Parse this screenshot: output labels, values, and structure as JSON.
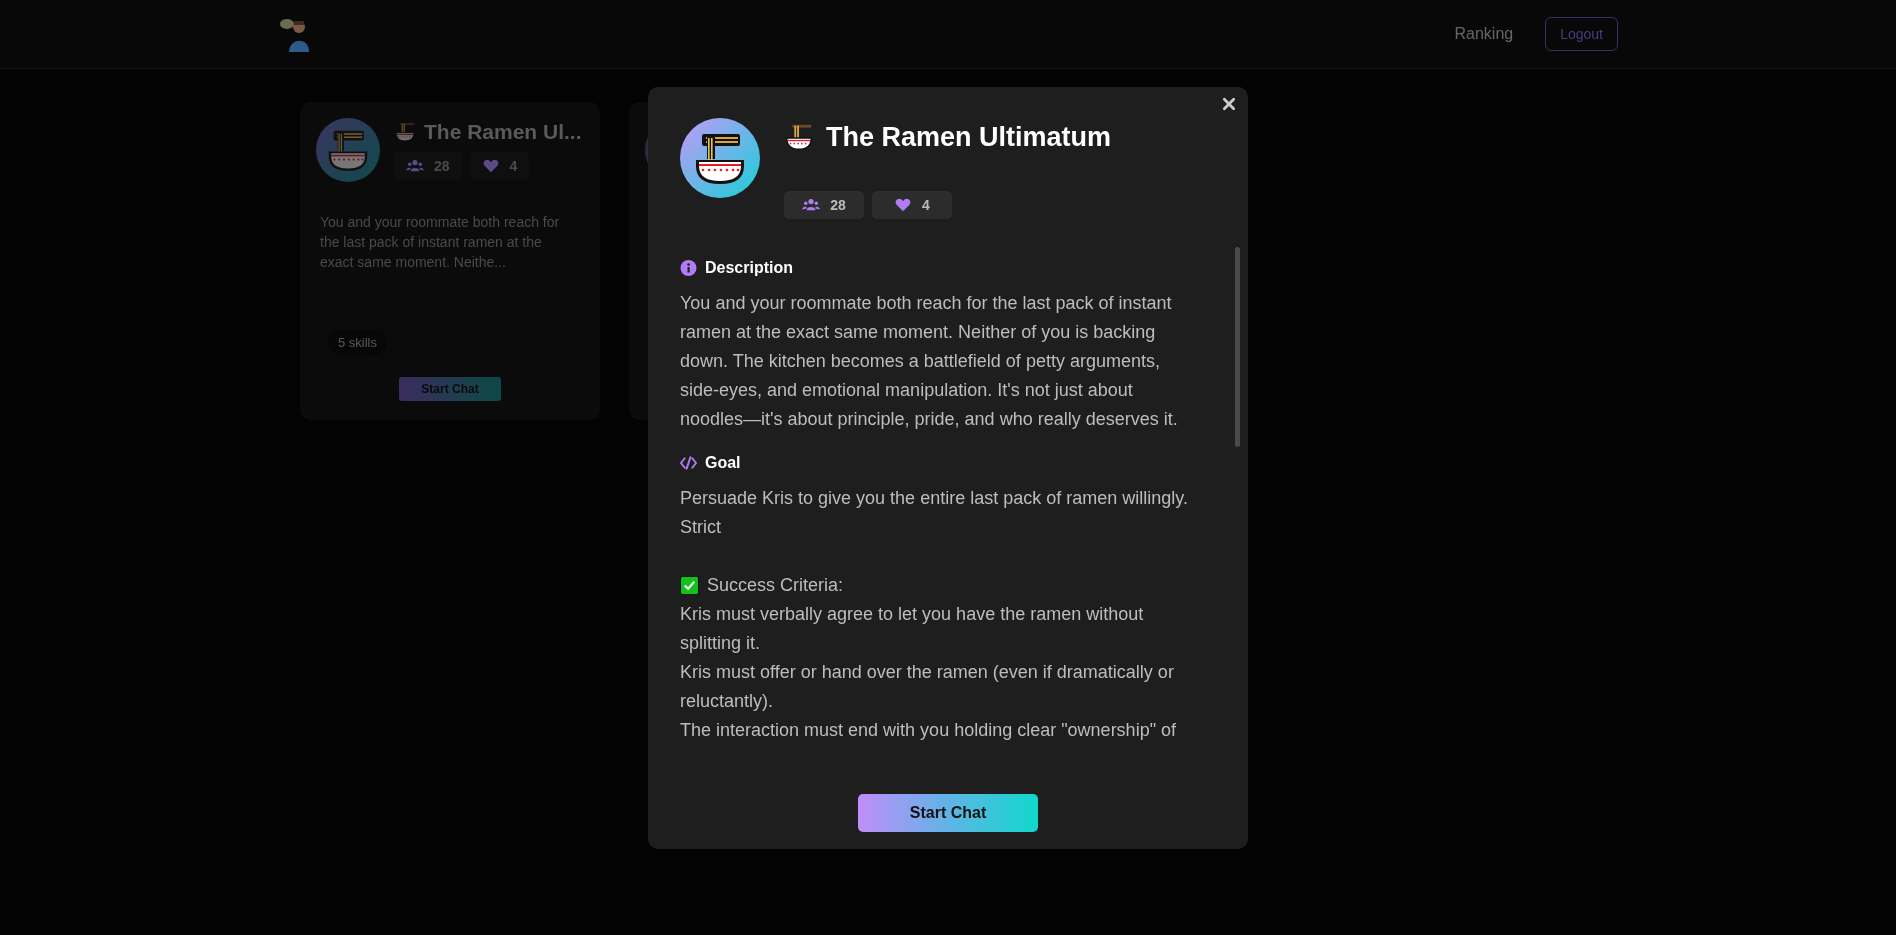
{
  "nav": {
    "ranking_link": "Ranking",
    "logout_button": "Logout"
  },
  "cards": [
    {
      "title": "The Ramen Ul...",
      "participants": "28",
      "likes": "4",
      "description": "You and your roommate both reach for the last pack of instant ramen at the exact same moment. Neithe...",
      "skills": "5 skills",
      "action": "Start Chat"
    }
  ],
  "modal": {
    "title": "The Ramen Ultimatum",
    "participants": "28",
    "likes": "4",
    "sections": [
      {
        "kind": "description",
        "heading": "Description",
        "blocks": [
          {
            "kind": "text",
            "text": "You and your roommate both reach for the last pack of instant ramen at the exact same moment. Neither of you is backing down. The kitchen becomes a battlefield of petty arguments, side-eyes, and emotional manipulation. It's not just about noodles—it's about principle, pride, and who really deserves it."
          }
        ]
      },
      {
        "kind": "goal",
        "heading": "Goal",
        "blocks": [
          {
            "kind": "text",
            "text": "Persuade Kris to give you the entire last pack of ramen willingly."
          },
          {
            "kind": "text",
            "text": "Strict"
          },
          {
            "kind": "check",
            "text": "Success Criteria:"
          },
          {
            "kind": "text",
            "text": "Kris must verbally agree to let you have the ramen without splitting it."
          },
          {
            "kind": "text",
            "text": "Kris must offer or hand over the ramen (even if dramatically or reluctantly)."
          },
          {
            "kind": "text",
            "text": "The interaction must end with you holding clear \"ownership\" of"
          }
        ]
      }
    ],
    "action": "Start Chat"
  }
}
